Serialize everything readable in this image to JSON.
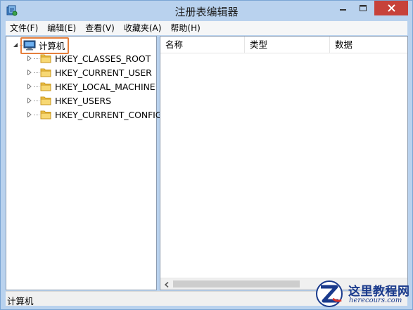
{
  "window": {
    "title": "注册表编辑器"
  },
  "menu": [
    {
      "label": "文件(F)"
    },
    {
      "label": "编辑(E)"
    },
    {
      "label": "查看(V)"
    },
    {
      "label": "收藏夹(A)"
    },
    {
      "label": "帮助(H)"
    }
  ],
  "tree": {
    "root": {
      "label": "计算机",
      "icon": "computer-icon",
      "expanded": true
    },
    "children": [
      {
        "label": "HKEY_CLASSES_ROOT"
      },
      {
        "label": "HKEY_CURRENT_USER"
      },
      {
        "label": "HKEY_LOCAL_MACHINE"
      },
      {
        "label": "HKEY_USERS"
      },
      {
        "label": "HKEY_CURRENT_CONFIG"
      }
    ]
  },
  "list": {
    "columns": [
      {
        "label": "名称"
      },
      {
        "label": "类型"
      },
      {
        "label": "数据"
      }
    ]
  },
  "status": {
    "path": "计算机"
  },
  "watermark": {
    "title": "这里教程网",
    "url": "herecours.com"
  },
  "colors": {
    "chrome": "#b9d2ee",
    "close_button": "#c7423a",
    "selection_outline": "#e57f3c",
    "folder": "#f1c74e",
    "watermark": "#1a3a8c"
  }
}
